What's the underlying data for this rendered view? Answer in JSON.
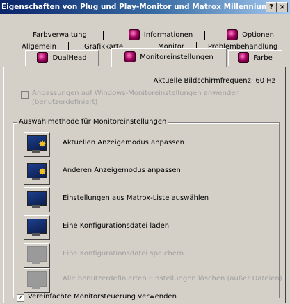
{
  "window": {
    "title": "Eigenschaften von Plug und Play-Monitor und Matrox Millennium...",
    "help_button": "?",
    "close_button": "×"
  },
  "tabs": {
    "row1": [
      "Farbverwaltung",
      "Informationen",
      "Optionen"
    ],
    "row2": [
      "Allgemein",
      "Grafikkarte",
      "Monitor",
      "Problembehandlung"
    ],
    "row3": [
      "DualHead",
      "Monitoreinstellungen",
      "Farbe"
    ],
    "active": "Monitoreinstellungen"
  },
  "panel": {
    "refresh_label": "Aktuelle Bildschirmfrequenz: 60 Hz",
    "apply_windows_check": "Anpassungen auf Windows-Monitoreinstellungen anwenden (benutzerdefiniert)",
    "group_label": "Auswahlmethode für Monitoreinstellungen",
    "options": [
      "Aktuellen Anzeigemodus anpassen",
      "Anderen Anzeigemodus anpassen",
      "Einstellungen aus Matrox-Liste auswählen",
      "Eine Konfigurationsdatei laden",
      "Eine Konfigurationsdatei speichern",
      "Alle benutzerdefinierten Einstellungen löschen (außer Dateien)"
    ],
    "simplified_check": "Vereinfachte Monitorsteuerung verwenden",
    "simplified_checked": true
  },
  "colors": {
    "title_start": "#0a246a",
    "title_end": "#a6caf0",
    "face": "#d4d0c8",
    "disabled_text": "#a0a0a0"
  }
}
